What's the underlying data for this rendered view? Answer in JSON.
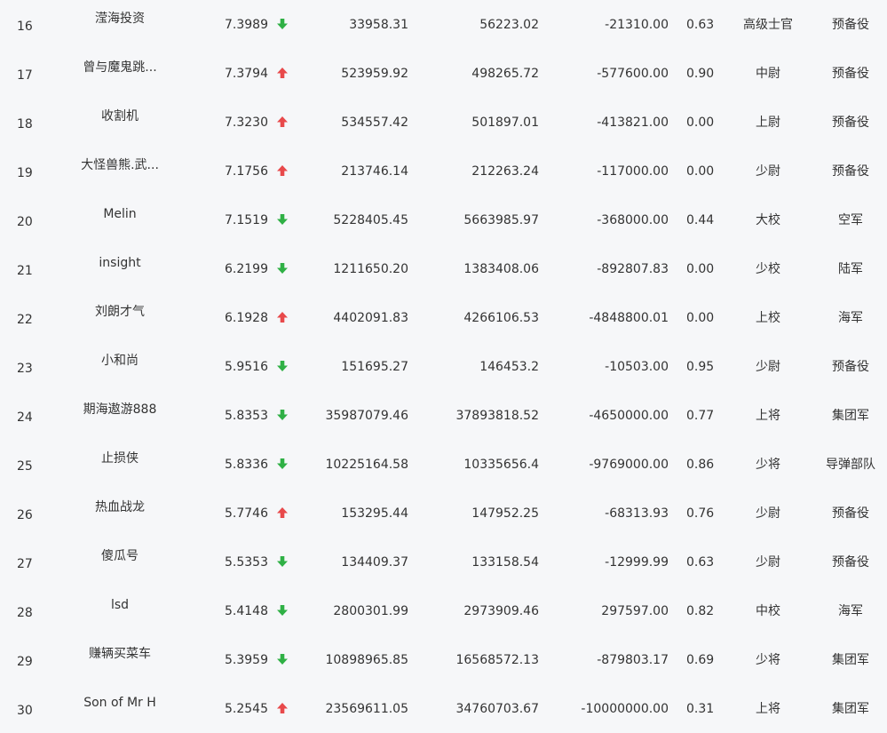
{
  "colors": {
    "background": "#f6f7f9",
    "text": "#333333",
    "up": "#e8494b",
    "down": "#2fb045"
  },
  "rows": [
    {
      "rank": "16",
      "name": "滢海投资",
      "score": "7.3989",
      "trend": "down",
      "v1": "33958.31",
      "v2": "56223.02",
      "v3": "-21310.00",
      "ratio": "0.63",
      "military_rank": "高级士官",
      "branch": "预备役"
    },
    {
      "rank": "17",
      "name": "曾与魔鬼跳...",
      "score": "7.3794",
      "trend": "up",
      "v1": "523959.92",
      "v2": "498265.72",
      "v3": "-577600.00",
      "ratio": "0.90",
      "military_rank": "中尉",
      "branch": "预备役"
    },
    {
      "rank": "18",
      "name": "收割机",
      "score": "7.3230",
      "trend": "up",
      "v1": "534557.42",
      "v2": "501897.01",
      "v3": "-413821.00",
      "ratio": "0.00",
      "military_rank": "上尉",
      "branch": "预备役"
    },
    {
      "rank": "19",
      "name": "大怪兽熊.武...",
      "score": "7.1756",
      "trend": "up",
      "v1": "213746.14",
      "v2": "212263.24",
      "v3": "-117000.00",
      "ratio": "0.00",
      "military_rank": "少尉",
      "branch": "预备役"
    },
    {
      "rank": "20",
      "name": "Melin",
      "score": "7.1519",
      "trend": "down",
      "v1": "5228405.45",
      "v2": "5663985.97",
      "v3": "-368000.00",
      "ratio": "0.44",
      "military_rank": "大校",
      "branch": "空军"
    },
    {
      "rank": "21",
      "name": "insight",
      "score": "6.2199",
      "trend": "down",
      "v1": "1211650.20",
      "v2": "1383408.06",
      "v3": "-892807.83",
      "ratio": "0.00",
      "military_rank": "少校",
      "branch": "陆军"
    },
    {
      "rank": "22",
      "name": "刘朗才气",
      "score": "6.1928",
      "trend": "up",
      "v1": "4402091.83",
      "v2": "4266106.53",
      "v3": "-4848800.01",
      "ratio": "0.00",
      "military_rank": "上校",
      "branch": "海军"
    },
    {
      "rank": "23",
      "name": "小和尚",
      "score": "5.9516",
      "trend": "down",
      "v1": "151695.27",
      "v2": "146453.2",
      "v3": "-10503.00",
      "ratio": "0.95",
      "military_rank": "少尉",
      "branch": "预备役"
    },
    {
      "rank": "24",
      "name": "期海遨游888",
      "score": "5.8353",
      "trend": "down",
      "v1": "35987079.46",
      "v2": "37893818.52",
      "v3": "-4650000.00",
      "ratio": "0.77",
      "military_rank": "上将",
      "branch": "集团军"
    },
    {
      "rank": "25",
      "name": "止损侠",
      "score": "5.8336",
      "trend": "down",
      "v1": "10225164.58",
      "v2": "10335656.4",
      "v3": "-9769000.00",
      "ratio": "0.86",
      "military_rank": "少将",
      "branch": "导弹部队"
    },
    {
      "rank": "26",
      "name": "热血战龙",
      "score": "5.7746",
      "trend": "up",
      "v1": "153295.44",
      "v2": "147952.25",
      "v3": "-68313.93",
      "ratio": "0.76",
      "military_rank": "少尉",
      "branch": "预备役"
    },
    {
      "rank": "27",
      "name": "傻瓜号",
      "score": "5.5353",
      "trend": "down",
      "v1": "134409.37",
      "v2": "133158.54",
      "v3": "-12999.99",
      "ratio": "0.63",
      "military_rank": "少尉",
      "branch": "预备役"
    },
    {
      "rank": "28",
      "name": "lsd",
      "score": "5.4148",
      "trend": "down",
      "v1": "2800301.99",
      "v2": "2973909.46",
      "v3": "297597.00",
      "ratio": "0.82",
      "military_rank": "中校",
      "branch": "海军"
    },
    {
      "rank": "29",
      "name": "赚辆买菜车",
      "score": "5.3959",
      "trend": "down",
      "v1": "10898965.85",
      "v2": "16568572.13",
      "v3": "-879803.17",
      "ratio": "0.69",
      "military_rank": "少将",
      "branch": "集团军"
    },
    {
      "rank": "30",
      "name": "Son of Mr H",
      "score": "5.2545",
      "trend": "up",
      "v1": "23569611.05",
      "v2": "34760703.67",
      "v3": "-10000000.00",
      "ratio": "0.31",
      "military_rank": "上将",
      "branch": "集团军"
    }
  ]
}
